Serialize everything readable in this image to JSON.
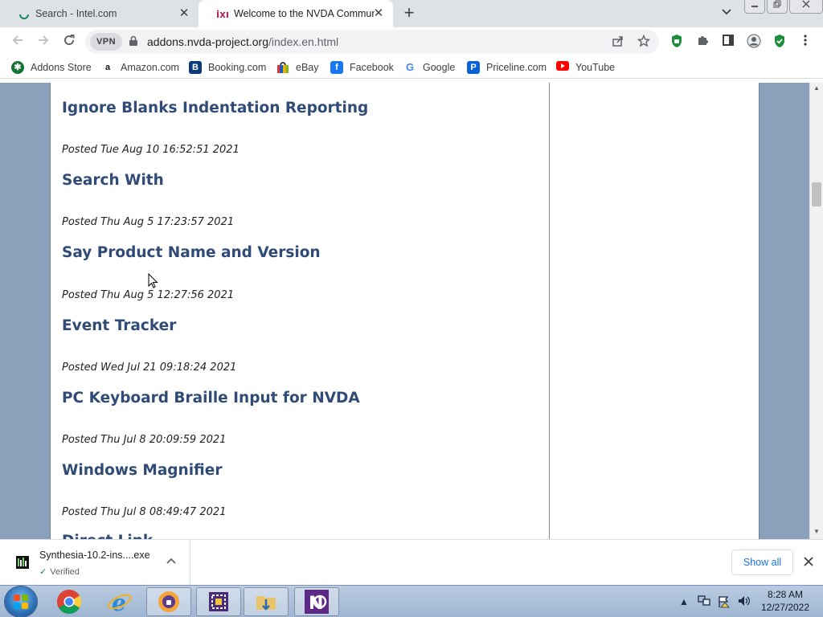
{
  "browser": {
    "tabs": [
      {
        "title": "Search - Intel.com",
        "active": false
      },
      {
        "title": "Welcome to the NVDA Community Add-ons website",
        "active": true
      }
    ],
    "new_tab_glyph": "+",
    "close_glyph": "✕",
    "url_host": "addons.nvda-project.org",
    "url_path": "/index.en.html",
    "vpn_label": "VPN"
  },
  "bookmarks": [
    {
      "label": "Addons Store",
      "icon": "addons-store-icon"
    },
    {
      "label": "Amazon.com",
      "icon": "amazon-icon"
    },
    {
      "label": "Booking.com",
      "icon": "booking-icon"
    },
    {
      "label": "eBay",
      "icon": "ebay-icon"
    },
    {
      "label": "Facebook",
      "icon": "facebook-icon"
    },
    {
      "label": "Google",
      "icon": "google-icon"
    },
    {
      "label": "Priceline.com",
      "icon": "priceline-icon"
    },
    {
      "label": "YouTube",
      "icon": "youtube-icon"
    }
  ],
  "posts": [
    {
      "title": "Ignore Blanks Indentation Reporting",
      "date": "Posted Tue Aug 10 16:52:51 2021"
    },
    {
      "title": "Search With",
      "date": "Posted Thu Aug 5 17:23:57 2021"
    },
    {
      "title": "Say Product Name and Version",
      "date": "Posted Thu Aug 5 12:27:56 2021"
    },
    {
      "title": "Event Tracker",
      "date": "Posted Wed Jul 21 09:18:24 2021"
    },
    {
      "title": "PC Keyboard Braille Input for NVDA",
      "date": "Posted Thu Jul 8 20:09:59 2021"
    },
    {
      "title": "Windows Magnifier",
      "date": "Posted Thu Jul 8 08:49:47 2021"
    },
    {
      "title": "Direct Link",
      "date": ""
    }
  ],
  "download": {
    "filename": "Synthesia-10.2-ins....exe",
    "status": "Verified",
    "show_all": "Show all"
  },
  "taskbar": {
    "time": "8:28 AM",
    "date": "12/27/2022"
  },
  "colors": {
    "page_background": "#8ba0bb",
    "post_title": "#2f4b76",
    "link_blue": "#1a73e8"
  }
}
